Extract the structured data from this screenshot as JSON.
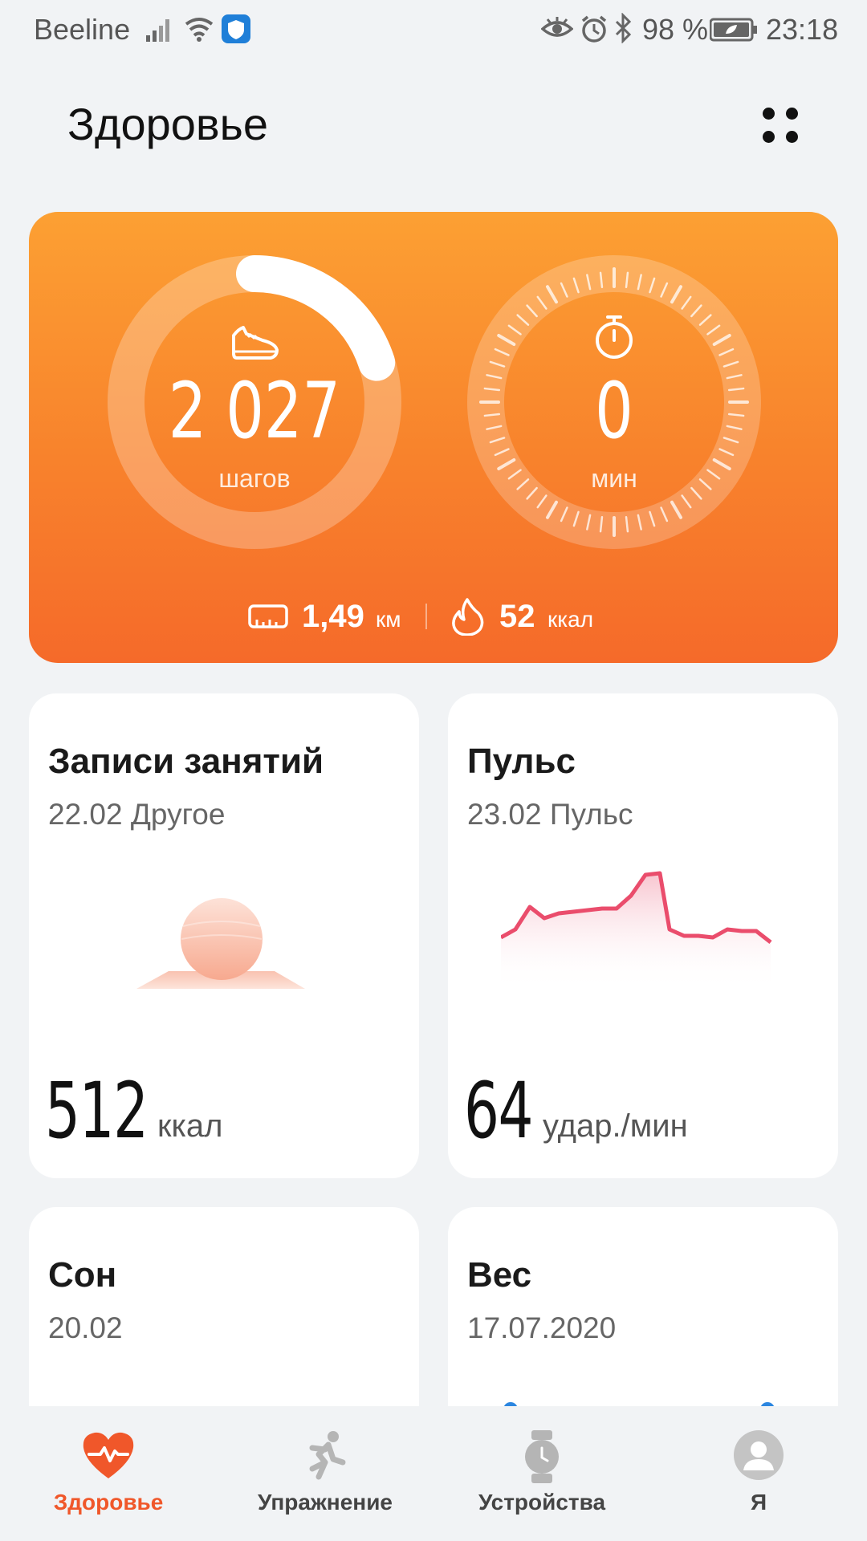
{
  "status_bar": {
    "carrier": "Beeline",
    "battery": "98 %",
    "time": "23:18"
  },
  "header": {
    "title": "Здоровье"
  },
  "activity": {
    "steps_value": "2 027",
    "steps_unit": "шагов",
    "steps_progress": 0.2,
    "minutes_value": "0",
    "minutes_unit": "мин",
    "distance_value": "1,49",
    "distance_unit": "км",
    "calories_value": "52",
    "calories_unit": "ккал"
  },
  "cards": {
    "workouts": {
      "title": "Записи занятий",
      "subtitle": "22.02 Другое",
      "value": "512",
      "unit": "ккал"
    },
    "pulse": {
      "title": "Пульс",
      "subtitle": "23.02 Пульс",
      "value": "64",
      "unit": "удар./мин"
    },
    "sleep": {
      "title": "Сон",
      "subtitle": "20.02"
    },
    "weight": {
      "title": "Вес",
      "subtitle": "17.07.2020"
    }
  },
  "bottom_nav": [
    {
      "label": "Здоровье",
      "icon": "heart-pulse-icon",
      "active": true
    },
    {
      "label": "Упражнение",
      "icon": "running-person-icon",
      "active": false
    },
    {
      "label": "Устройства",
      "icon": "watch-icon",
      "active": false
    },
    {
      "label": "Я",
      "icon": "avatar-icon",
      "active": false
    }
  ],
  "colors": {
    "accent": "#f0572a",
    "hero_top": "#fca033",
    "hero_bottom": "#f56a2a",
    "pulse_line": "#ea4d6c"
  }
}
